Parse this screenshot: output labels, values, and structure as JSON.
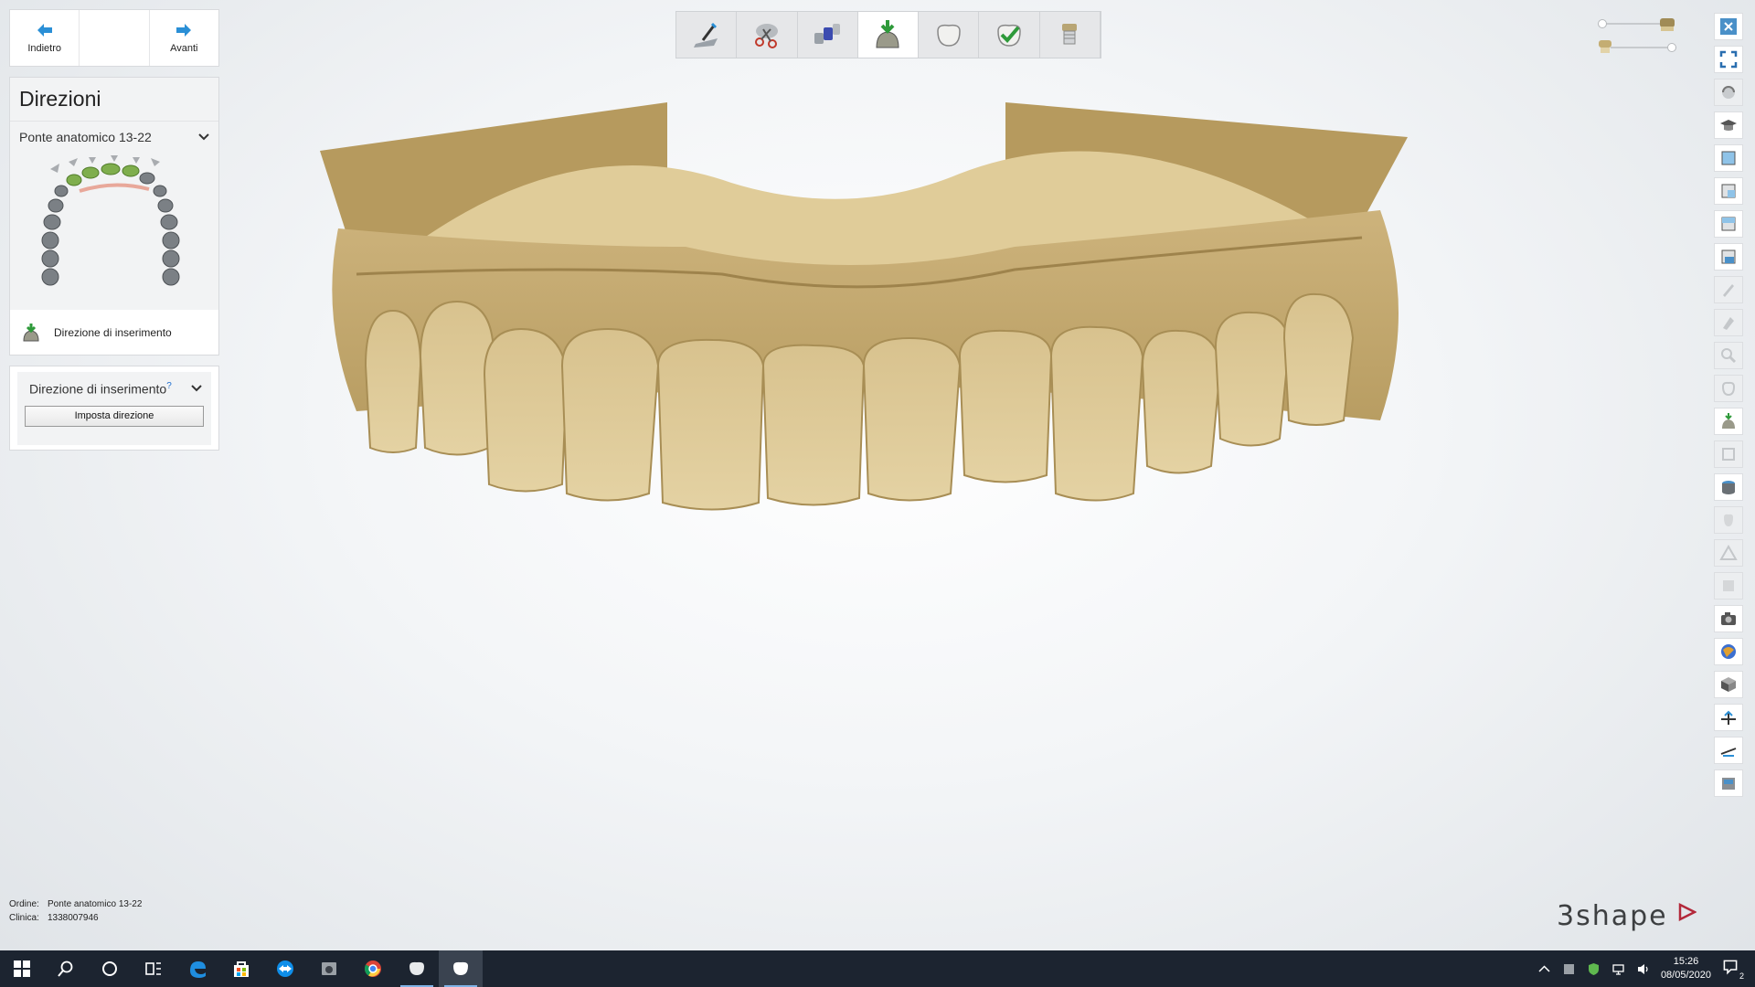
{
  "nav": {
    "back_label": "Indietro",
    "forward_label": "Avanti"
  },
  "panel": {
    "title": "Direzioni",
    "order_name": "Ponte anatomico 13-22",
    "step_label": "Direzione di inserimento"
  },
  "insertion": {
    "header": "Direzione di inserimento",
    "help_mark": "?",
    "set_button": "Imposta direzione"
  },
  "workflow": {
    "steps": [
      {
        "icon": "scan-plane-icon"
      },
      {
        "icon": "trim-scissors-icon"
      },
      {
        "icon": "segment-die-icon"
      },
      {
        "icon": "insertion-direction-icon"
      },
      {
        "icon": "margin-line-icon"
      },
      {
        "icon": "design-check-icon"
      },
      {
        "icon": "export-die-icon"
      }
    ],
    "active_index": 3
  },
  "order_info": {
    "order_label": "Ordine:",
    "order_value": "Ponte anatomico 13-22",
    "clinic_label": "Clinica:",
    "clinic_value": "1338007946"
  },
  "logo": {
    "text": "3shape",
    "accent_color": "#b3283a"
  },
  "taskbar": {
    "time": "15:26",
    "date": "08/05/2020",
    "notification_count": "2"
  },
  "colors": {
    "model": "#d9c390",
    "accent_blue": "#2a8fd6",
    "taskbar": "#1c2430"
  }
}
